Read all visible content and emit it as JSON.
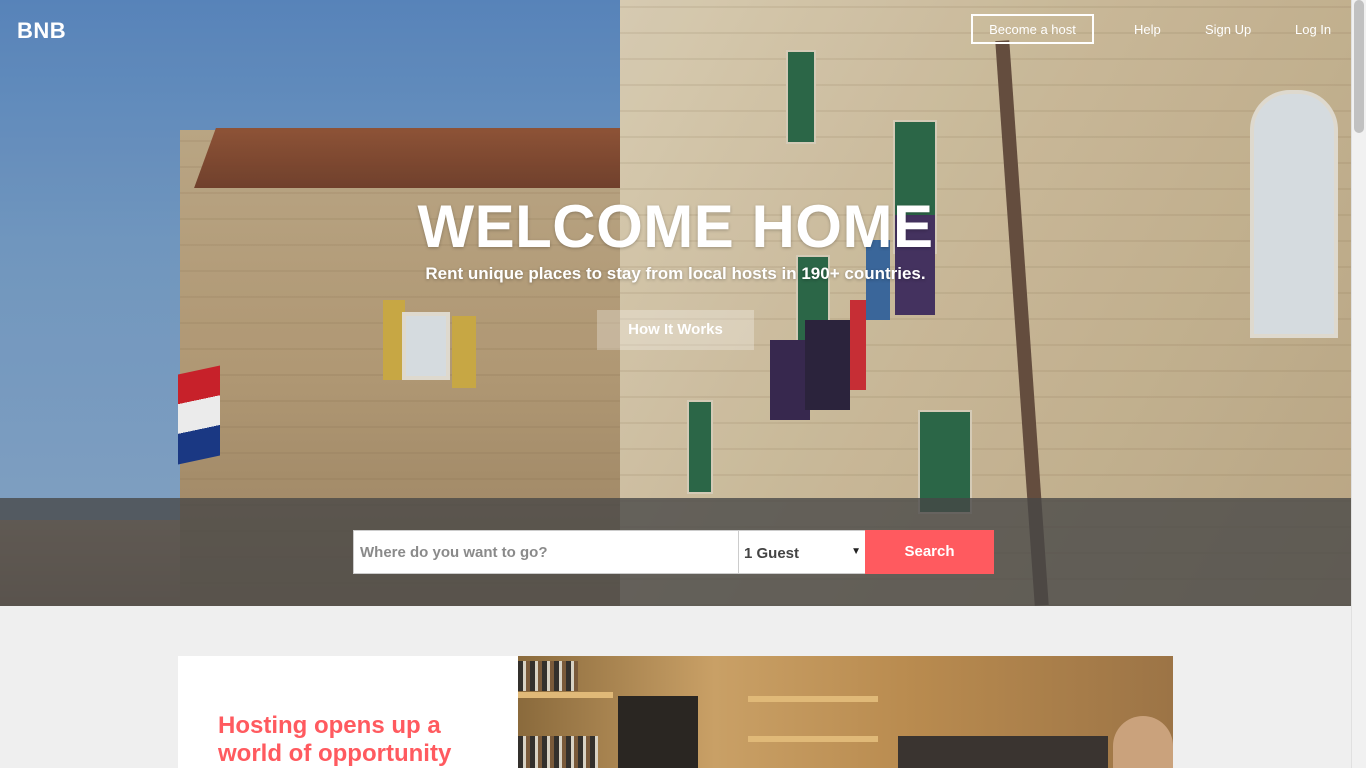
{
  "brand": {
    "logo": "BNB",
    "accent_color": "#ff5a5f"
  },
  "nav": {
    "become_host": "Become a host",
    "help": "Help",
    "sign_up": "Sign Up",
    "log_in": "Log In"
  },
  "hero": {
    "title": "WELCOME HOME",
    "subtitle": "Rent unique places to stay from local hosts in 190+ countries.",
    "how_it_works": "How It Works"
  },
  "search": {
    "placeholder": "Where do you want to go?",
    "guests_selected": "1 Guest",
    "button": "Search"
  },
  "feature": {
    "heading": "Hosting opens up a world of opportunity"
  }
}
